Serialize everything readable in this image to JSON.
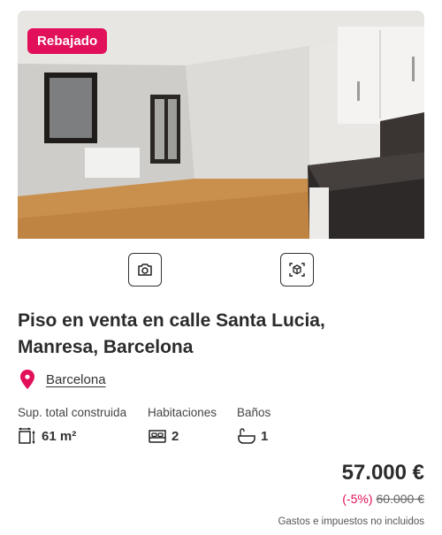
{
  "listing": {
    "badge": "Rebajado",
    "title": "Piso en venta en calle Santa Lucia, Manresa, Barcelona",
    "location": "Barcelona",
    "features": [
      {
        "label": "Sup. total construida",
        "value": "61 m²",
        "icon": "area-icon"
      },
      {
        "label": "Habitaciones",
        "value": "2",
        "icon": "bed-icon"
      },
      {
        "label": "Baños",
        "value": "1",
        "icon": "bathtub-icon"
      }
    ],
    "price": "57.000 €",
    "discount": "(-5%)",
    "old_price": "60.000 €",
    "note": "Gastos e impuestos no incluidos"
  },
  "media_buttons": [
    "camera-icon",
    "virtual-tour-icon"
  ],
  "colors": {
    "accent": "#e2105a",
    "text": "#2b2b2b"
  }
}
